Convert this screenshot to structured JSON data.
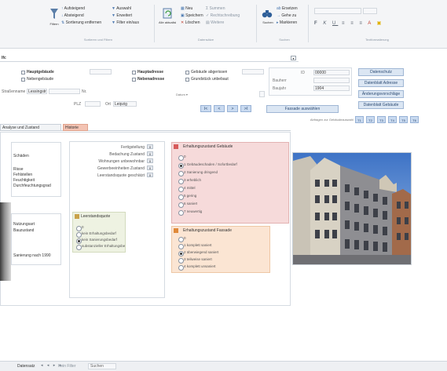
{
  "ribbon": {
    "groups": [
      {
        "label": "Sortieren und Filtern",
        "items": [
          "Aufsteigend",
          "Absteigend",
          "Sortierung entfernen",
          "Filtern"
        ]
      },
      {
        "label": "Datensätze",
        "items": [
          "Auswahl",
          "Erweitert",
          "Filter ein/aus",
          "Alle aktualisieren",
          "Neu",
          "Speichern",
          "Löschen"
        ]
      },
      {
        "label": "Suchen",
        "items": [
          "Suchen",
          "Ersetzen",
          "Gehe zu",
          "Markieren"
        ]
      },
      {
        "label": "Textformatierung",
        "items": []
      }
    ],
    "big_buttons": [
      "Filtern",
      "Alle aktualisieren",
      "Suchen"
    ]
  },
  "header": {
    "record_label": "Ifc",
    "hauptgebaeude": "Hauptgebäude",
    "nebengebaeude": "Nebengebäude",
    "hauptadresse": "Hauptadresse",
    "nebenadresse": "Nebenadresse",
    "gebaeude_abgerissen": "Gebäude abgerissen",
    "grundstueck_unbebaut": "Grundstück unbebaut",
    "id_value": "00000",
    "bauherr": "Bauherr",
    "baujahr_value": "1904",
    "strasse_label": "Straßenname",
    "strasse_value": "Lessingstraße",
    "plz_label": "PLZ",
    "nr_label": "Nr.",
    "ort_label": "Ort",
    "ort_value": "Leipzig"
  },
  "right_buttons": [
    "Datenschutz",
    "Datenblatt Adresse",
    "Änderungsvorschläge",
    "Datenblatt Gebäude"
  ],
  "nav": {
    "first": "I<",
    "prev": "<",
    "next": ">",
    "last": ">I",
    "action_button": "Fassade auswählen",
    "abfragen_label": "Abfragen zur Gebäudeauswahl",
    "tags": [
      "T1",
      "T2",
      "T3",
      "T4",
      "T5",
      "T6"
    ]
  },
  "tabs": [
    "Analyse und Zustand",
    "Historie"
  ],
  "left_panel": {
    "items": [
      "Schäden",
      "",
      "Risse",
      "Fehlstellen",
      "Feuchtigkeit",
      "Durchfeuchtungsgrad",
      "Nutzungsart",
      "Bauzustand",
      "",
      "Sanierung nach 1990"
    ]
  },
  "mid_panel": {
    "rows": [
      {
        "label": "Fertigstellung",
        "value": "0"
      },
      {
        "label": "Bedachung Zustand",
        "value": "0"
      },
      {
        "label": "Wohnungen unbewohnbar",
        "value": "0"
      },
      {
        "label": "Gewerbeeinheiten Zustand",
        "value": "0"
      },
      {
        "label": "Leerstandsquote geschätzt",
        "value": "0"
      }
    ],
    "group_title": "Leerstandsquote",
    "group_options": [
      "0",
      "kein Erhaltungsbedarf",
      "kein Sanierungsbedarf",
      "substanzieller Erhaltungsbedarf"
    ]
  },
  "pink_group": {
    "title": "Erhaltungszustand Gebäude",
    "options": [
      "0",
      "1 Gebäudeschaden / Sofortbedarf",
      "2 Sanierung dringend",
      "3 erheblich",
      "4 mittel",
      "5 gering",
      "6 saniert",
      "7 neuwertig"
    ]
  },
  "orange_group": {
    "title": "Erhaltungszustand Fassade",
    "options": [
      "0",
      "1 komplett saniert",
      "2 überwiegend saniert",
      "3 teilweise saniert",
      "4 komplett unsaniert"
    ]
  },
  "photo": {
    "alt": "Gründerzeitliches Eckhaus"
  },
  "status_bar": {
    "record_text": "Datensatz",
    "filter_text": "Kein Filter",
    "search_text": "Suchen"
  },
  "colors": {
    "accent": "#2f6fb6",
    "pink": "#f6dada",
    "orange": "#fbe5d3",
    "tab": "#f3c3b3"
  }
}
